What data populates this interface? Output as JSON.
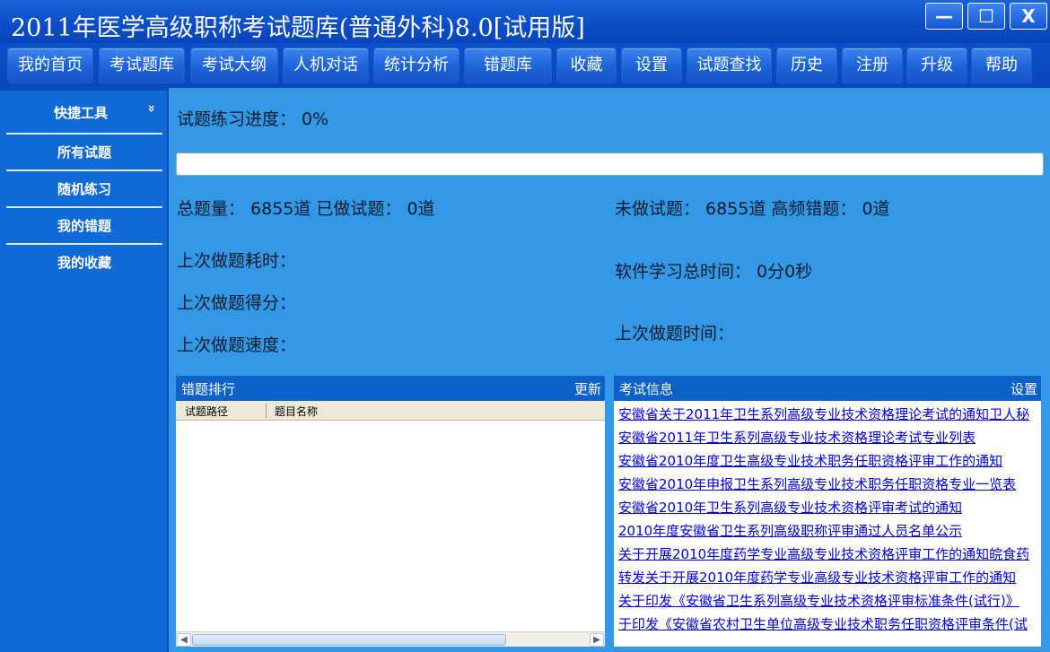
{
  "window": {
    "title": "2011年医学高级职称考试题库(普通外科)8.0[试用版]",
    "min_glyph": "—",
    "max_glyph": "☐",
    "close_glyph": "X"
  },
  "toolbar": {
    "buttons": [
      "我的首页",
      "考试题库",
      "考试大纲",
      "人机对话",
      "统计分析",
      "错题库",
      "收藏",
      "设置",
      "试题查找",
      "历史",
      "注册",
      "升级",
      "帮助"
    ]
  },
  "sidebar": {
    "header": "快捷工具",
    "chevron": "»",
    "items": [
      "所有试题",
      "随机练习",
      "我的错题",
      "我的收藏"
    ]
  },
  "stats": {
    "progress_line": "试题练习进度：  0%",
    "progress_value": 0,
    "total_line": "总题量：  6855道 已做试题：  0道",
    "undone_line": "未做试题：  6855道 高频错题：  0道",
    "last_duration": "上次做题耗时：",
    "total_study_time": "软件学习总时间：  0分0秒",
    "last_score": "上次做题得分：",
    "last_time": "上次做题时间：",
    "last_speed": "上次做题速度："
  },
  "wrong_ranking": {
    "title": "错题排行",
    "action": "更新",
    "columns": [
      "试题路径",
      "题目名称"
    ],
    "rows": []
  },
  "exam_info": {
    "title": "考试信息",
    "action": "设置",
    "links": [
      "安徽省关于2011年卫生系列高级专业技术资格理论考试的通知卫人秘",
      "安徽省2011年卫生系列高级专业技术资格理论考试专业列表",
      "安徽省2010年度卫生高级专业技术职务任职资格评审工作的通知",
      "安徽省2010年申报卫生系列高级专业技术职务任职资格专业一览表",
      "安徽省2010年卫生系列高级专业技术资格评审考试的通知",
      "2010年度安徽省卫生系列高级职称评审通过人员名单公示",
      "关于开展2010年度药学专业高级专业技术资格评审工作的通知皖食药",
      "转发关于开展2010年度药学专业高级专业技术资格评审工作的通知",
      "关于印发《安徽省卫生系列高级专业技术资格评审标准条件(试行)》",
      "于印发《安徽省农村卫生单位高级专业技术职务任职资格评审条件(试"
    ]
  }
}
